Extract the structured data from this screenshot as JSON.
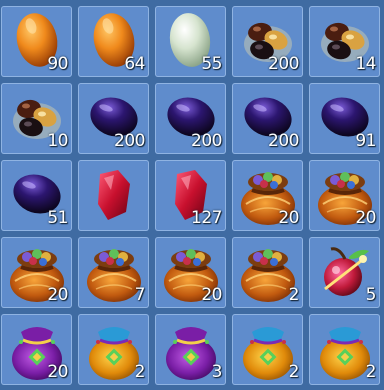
{
  "inventory": {
    "items": [
      {
        "icon": "orange-egg-icon",
        "count": "90"
      },
      {
        "icon": "orange-egg-icon",
        "count": "64"
      },
      {
        "icon": "jade-egg-icon",
        "count": "55"
      },
      {
        "icon": "mixed-gems-icon",
        "count": "200"
      },
      {
        "icon": "mixed-gems-icon",
        "count": "14"
      },
      {
        "icon": "mixed-gems-icon",
        "count": "10"
      },
      {
        "icon": "dark-purple-gem-icon",
        "count": "200"
      },
      {
        "icon": "dark-purple-gem-icon",
        "count": "200"
      },
      {
        "icon": "dark-purple-gem-icon",
        "count": "200"
      },
      {
        "icon": "dark-purple-gem-icon",
        "count": "91"
      },
      {
        "icon": "dark-purple-gem-icon",
        "count": "51"
      },
      {
        "icon": "red-gem-icon",
        "count": ""
      },
      {
        "icon": "red-gem-icon",
        "count": "127"
      },
      {
        "icon": "gem-pouch-icon",
        "count": "20"
      },
      {
        "icon": "gem-pouch-icon",
        "count": "20"
      },
      {
        "icon": "gem-pouch-icon",
        "count": "20"
      },
      {
        "icon": "gem-pouch-icon",
        "count": "7"
      },
      {
        "icon": "gem-pouch-icon",
        "count": "20"
      },
      {
        "icon": "gem-pouch-icon",
        "count": "2"
      },
      {
        "icon": "magic-fruit-icon",
        "count": "5"
      },
      {
        "icon": "purple-pouch-icon",
        "count": "20"
      },
      {
        "icon": "gold-pouch-icon",
        "count": "2"
      },
      {
        "icon": "purple-pouch-icon",
        "count": "3"
      },
      {
        "icon": "gold-pouch-icon",
        "count": "2"
      },
      {
        "icon": "gold-pouch-icon",
        "count": "2"
      }
    ]
  }
}
